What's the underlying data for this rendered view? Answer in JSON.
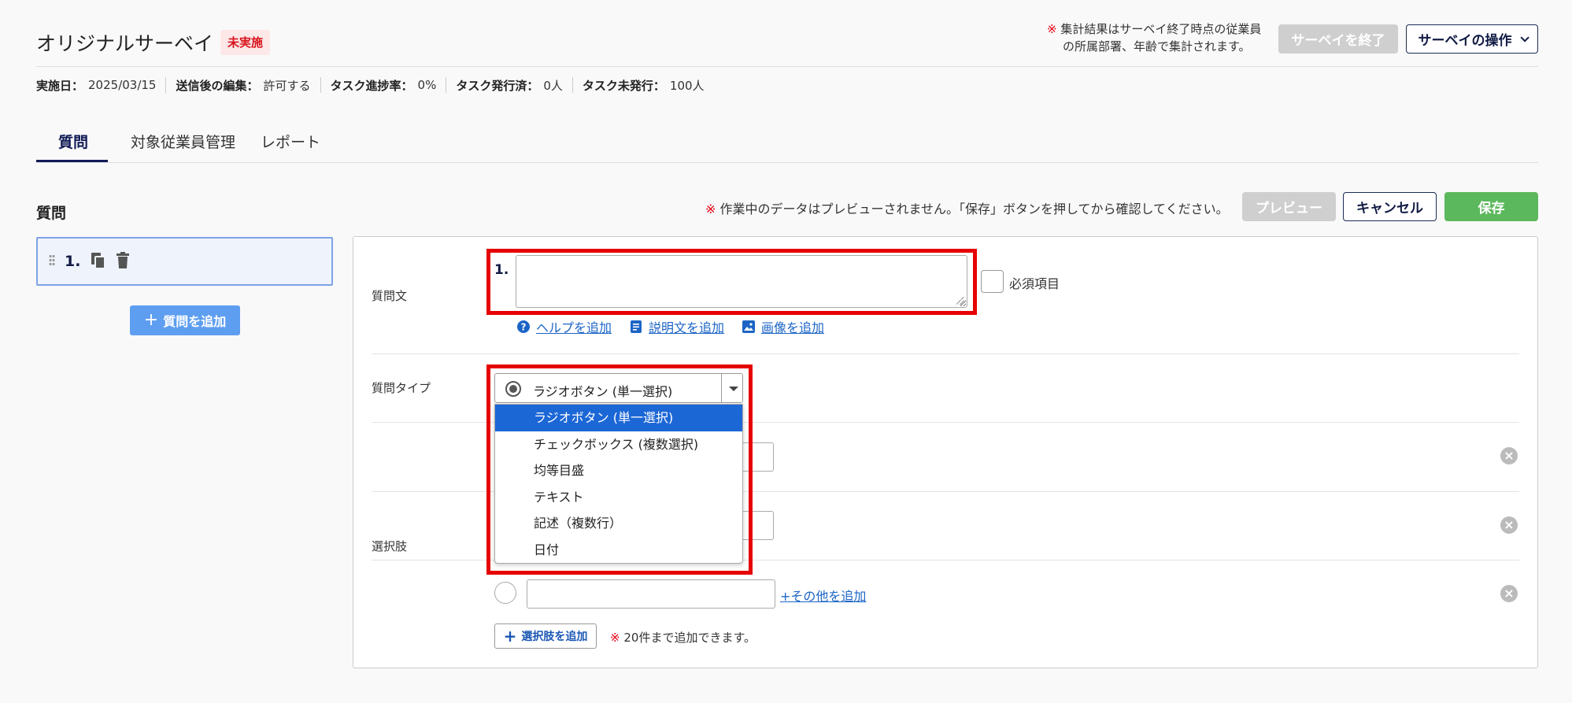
{
  "header": {
    "title": "オリジナルサーベイ",
    "status": "未実施",
    "notice_mark": "※",
    "notice_line1": "集計結果はサーベイ終了時点の従業員",
    "notice_line2": "の所属部署、年齢で集計されます。",
    "end_button": "サーベイを終了",
    "ops_button": "サーベイの操作"
  },
  "meta": {
    "date_label": "実施日：",
    "date_value": "2025/03/15",
    "edit_label": "送信後の編集：",
    "edit_value": "許可する",
    "progress_label": "タスク進捗率：",
    "progress_value": "0%",
    "issued_label": "タスク発行済：",
    "issued_value": "0人",
    "unissued_label": "タスク未発行：",
    "unissued_value": "100人"
  },
  "tabs": [
    {
      "label": "質問",
      "active": true
    },
    {
      "label": "対象従業員管理",
      "active": false
    },
    {
      "label": "レポート",
      "active": false
    }
  ],
  "sidebar": {
    "section_label": "質問",
    "question_number": "1.",
    "add_question": "質問を追加"
  },
  "toolbar": {
    "notice_mark": "※",
    "notice": "作業中のデータはプレビューされません。「保存」ボタンを押してから確認してください。",
    "preview": "プレビュー",
    "cancel": "キャンセル",
    "save": "保存"
  },
  "editor": {
    "question_text_label": "質問文",
    "question_number": "1.",
    "question_text_value": "",
    "required_label": "必須項目",
    "help_link": "ヘルプを追加",
    "description_link": "説明文を追加",
    "image_link": "画像を追加",
    "type_label": "質問タイプ",
    "type_value": "ラジオボタン (単一選択)",
    "type_options": [
      "ラジオボタン (単一選択)",
      "チェックボックス (複数選択)",
      "均等目盛",
      "テキスト",
      "記述（複数行）",
      "日付"
    ],
    "choices_label": "選択肢",
    "add_other": "+その他を追加",
    "add_choice": "選択肢を追加",
    "max_note_mark": "※",
    "max_note": "20件まで追加できます。"
  },
  "colors": {
    "accent_navy": "#111b55",
    "status_red": "#d8141c",
    "save_green": "#5cb85c",
    "add_blue": "#5e9ef0",
    "selected_option": "#1c67d6",
    "highlight": "#e60000"
  }
}
